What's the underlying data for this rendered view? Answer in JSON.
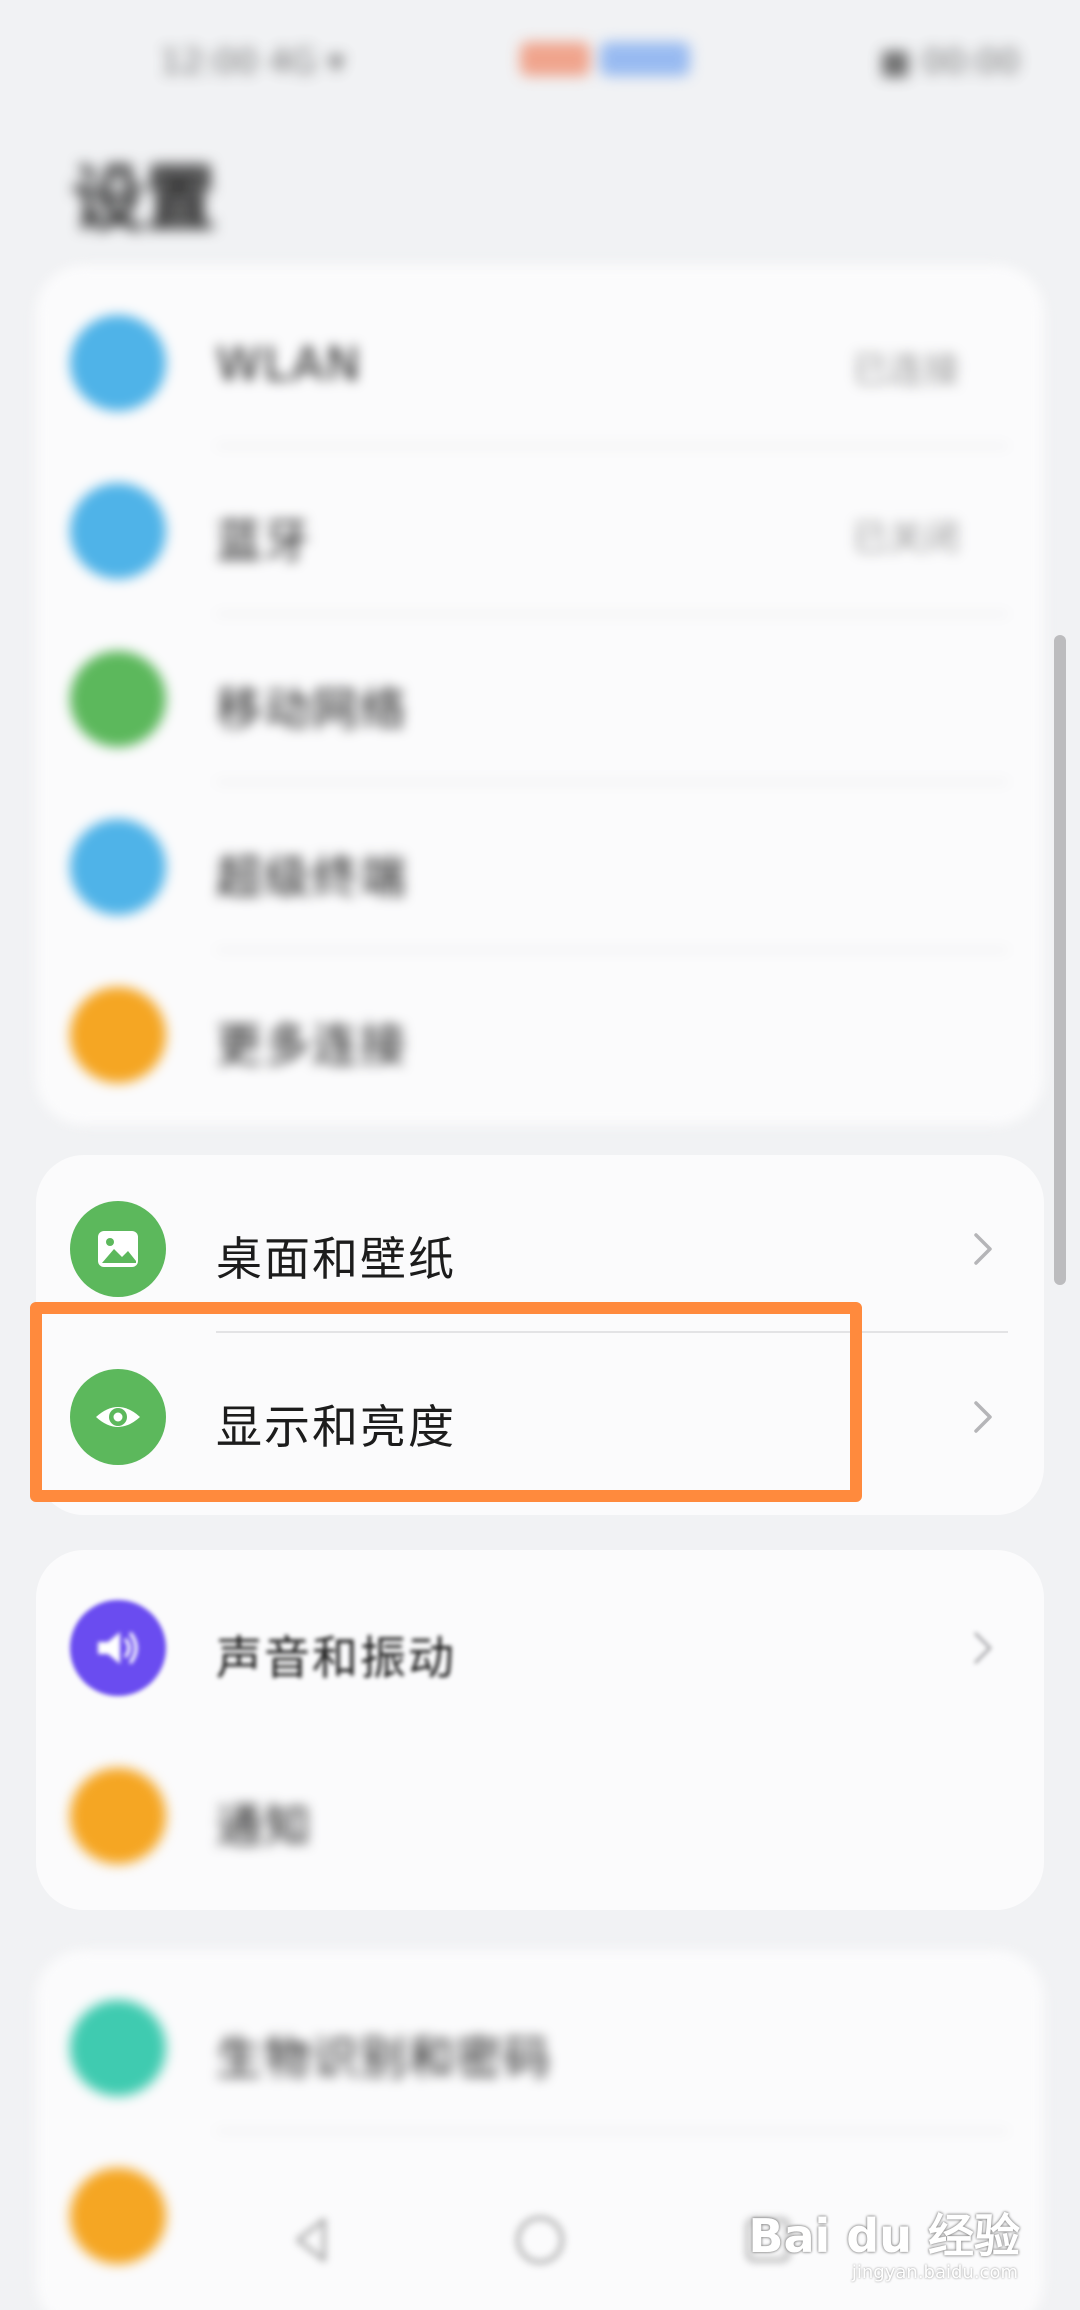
{
  "status_bar": {
    "left_text": "12:00 4G ▾",
    "right_text": "■ 00:00"
  },
  "page": {
    "title": "设置"
  },
  "groups": [
    {
      "items": [
        {
          "label": "WLAN",
          "value": "已连接",
          "icon": "wifi-icon",
          "color": "#4fb3e8"
        },
        {
          "label": "蓝牙",
          "value": "已关闭",
          "icon": "bluetooth-icon",
          "color": "#4fb3e8"
        },
        {
          "label": "移动网络",
          "value": "",
          "icon": "mobile-network-icon",
          "color": "#5cb85c"
        },
        {
          "label": "超级终端",
          "value": "",
          "icon": "super-device-icon",
          "color": "#4fb3e8"
        },
        {
          "label": "更多连接",
          "value": "",
          "icon": "more-connections-icon",
          "color": "#f5a623"
        }
      ]
    },
    {
      "items": [
        {
          "label": "桌面和壁纸",
          "icon": "picture-icon",
          "color": "#5cb85c"
        },
        {
          "label": "显示和亮度",
          "icon": "eye-icon",
          "color": "#5cb85c"
        }
      ]
    },
    {
      "items": [
        {
          "label": "声音和振动",
          "icon": "speaker-icon",
          "color": "#6a4cf0"
        },
        {
          "label": "通知",
          "icon": "bell-icon",
          "color": "#f5a623"
        }
      ]
    },
    {
      "items": [
        {
          "label": "生物识别和密码",
          "icon": "key-icon",
          "color": "#3fcbb0"
        },
        {
          "label": "",
          "icon": "app-icon",
          "color": "#f5a623"
        }
      ]
    }
  ],
  "highlight": {
    "color": "#ff8a3d"
  },
  "watermark": {
    "brand": "Bai du 经验",
    "url": "jingyan.baidu.com"
  }
}
